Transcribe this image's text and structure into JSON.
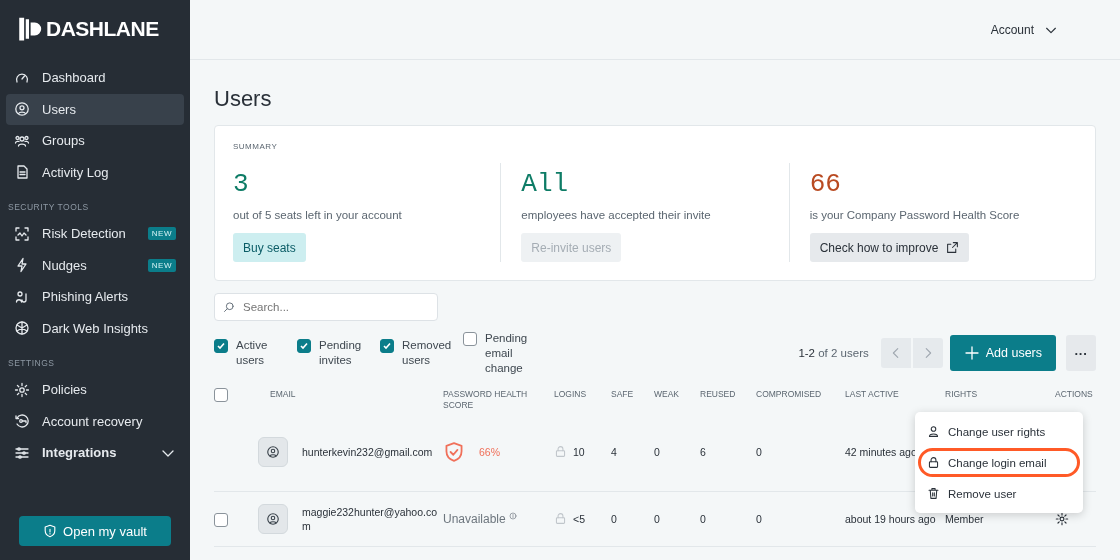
{
  "brand": {
    "name": "DASHLANE"
  },
  "sidebar": {
    "sections": [
      {
        "items": [
          {
            "label": "Dashboard",
            "selected": false
          },
          {
            "label": "Users",
            "selected": true
          },
          {
            "label": "Groups",
            "selected": false
          },
          {
            "label": "Activity Log",
            "selected": false
          }
        ]
      },
      {
        "title": "SECURITY TOOLS",
        "items": [
          {
            "label": "Risk Detection",
            "selected": false,
            "badge": "NEW"
          },
          {
            "label": "Nudges",
            "selected": false,
            "badge": "NEW"
          },
          {
            "label": "Phishing Alerts",
            "selected": false
          },
          {
            "label": "Dark Web Insights",
            "selected": false
          }
        ]
      },
      {
        "title": "SETTINGS",
        "items": [
          {
            "label": "Policies",
            "selected": false
          },
          {
            "label": "Account recovery",
            "selected": false
          },
          {
            "label": "Integrations",
            "selected": false,
            "expanded": false
          }
        ]
      }
    ],
    "vault_button": "Open my vault"
  },
  "header": {
    "account": "Account"
  },
  "page_title": "Users",
  "summary": {
    "title": "SUMMARY",
    "stats": [
      {
        "value": "3",
        "color": "#0e7c66",
        "caption": "out of 5 seats left in your account",
        "button": {
          "label": "Buy seats",
          "kind": "accent",
          "disabled": false
        }
      },
      {
        "value": "All",
        "color": "#0e7c66",
        "caption": "employees have accepted their invite",
        "button": {
          "label": "Re-invite users",
          "kind": "plain",
          "disabled": true
        }
      },
      {
        "value": "66",
        "color": "#b94a21",
        "caption": "is your Company Password Health Score",
        "button": {
          "label": "Check how to improve",
          "kind": "external",
          "disabled": false
        }
      }
    ]
  },
  "search": {
    "placeholder": "Search..."
  },
  "filters": [
    {
      "label": "Active users",
      "checked": true
    },
    {
      "label": "Pending invites",
      "checked": true
    },
    {
      "label": "Removed users",
      "checked": true
    },
    {
      "label": "Pending email change",
      "checked": false
    }
  ],
  "pagination": {
    "range": "1-2",
    "total": "of 2 users"
  },
  "add_button": "Add users",
  "more_button": "···",
  "table": {
    "select_all_checked": false,
    "columns": [
      "EMAIL",
      "PASSWORD HEALTH SCORE",
      "LOGINS",
      "SAFE",
      "WEAK",
      "REUSED",
      "COMPROMISED",
      "LAST ACTIVE",
      "RIGHTS",
      "ACTIONS"
    ],
    "rows": [
      {
        "kind": "scored",
        "email": "hunterkevin232@gmail.com",
        "score": "66%",
        "logins": "10",
        "safe": "4",
        "weak": "0",
        "reused": "6",
        "compromised": "0",
        "last_active": "42 minutes ago"
      },
      {
        "kind": "unavailable",
        "checked": false,
        "email": "maggie232hunter@yahoo.com",
        "score": "Unavailable",
        "logins": "<5",
        "safe": "0",
        "weak": "0",
        "reused": "0",
        "compromised": "0",
        "last_active": "about 19 hours ago",
        "rights": "Member"
      }
    ]
  },
  "menu": {
    "items": [
      {
        "label": "Change user rights",
        "highlighted": false
      },
      {
        "label": "Change login email",
        "highlighted": true
      },
      {
        "label": "Remove user",
        "highlighted": false
      }
    ]
  }
}
